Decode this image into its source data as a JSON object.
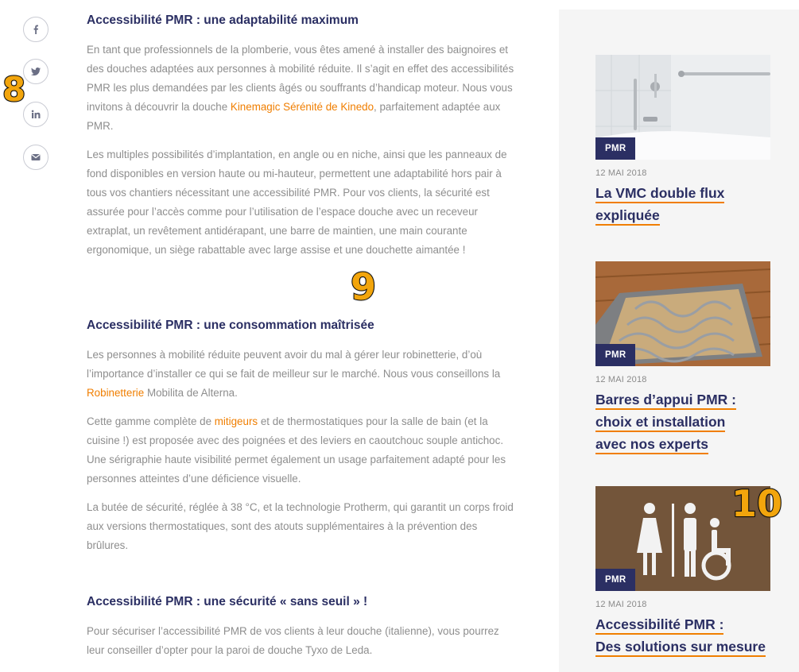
{
  "share": {
    "icons": [
      "facebook-icon",
      "twitter-icon",
      "linkedin-icon",
      "email-icon"
    ],
    "marker": "8"
  },
  "article": {
    "marker": "9",
    "sections": [
      {
        "heading": "Accessibilité PMR : une adaptabilité maximum",
        "p1_a": "En tant que professionnels de la plomberie, vous êtes amené à installer des baignoires et des douches adaptées aux personnes à mobilité réduite. Il s’agit en effet des accessibilités PMR les plus demandées par les clients âgés ou souffrants d’handicap moteur. Nous vous invitons à découvrir la douche ",
        "p1_link": "Kinemagic Sérénité de Kinedo",
        "p1_b": ", parfaitement adaptée aux PMR.",
        "p2": "Les multiples possibilités d’implantation, en angle ou en niche, ainsi que les panneaux de fond disponibles en version haute ou mi-hauteur, permettent une adaptabilité hors pair à tous vos chantiers nécessitant une accessibilité PMR. Pour vos clients, la sécurité est assurée pour l’accès comme pour l’utilisation de l’espace douche avec un receveur extraplat, un revêtement antidérapant, une barre de maintien, une main courante ergonomique, un siège rabattable avec large assise et une douchette aimantée !"
      },
      {
        "heading": "Accessibilité PMR : une consommation maîtrisée",
        "p1_a": "Les personnes à mobilité réduite peuvent avoir du mal à gérer leur robinetterie, d’où l’importance d’installer ce qui se fait de meilleur sur le marché. Nous vous conseillons la ",
        "p1_link": "Robinetterie",
        "p1_b": " Mobilita de Alterna.",
        "p2_a": "Cette gamme complète de ",
        "p2_link": "mitigeurs",
        "p2_b": " et de thermostatiques pour la salle de bain (et la cuisine !) est proposée avec des poignées et des leviers en caoutchouc souple antichoc. Une sérigraphie haute visibilité permet également un usage parfaitement adapté pour les personnes atteintes d’une déficience visuelle.",
        "p3": "La butée de sécurité, réglée à 38 °C, et la technologie Protherm, qui garantit un corps froid aux versions thermostatiques, sont des atouts supplémentaires à la prévention des brûlures."
      },
      {
        "heading": "Accessibilité PMR : une sécurité « sans seuil » !",
        "p1": "Pour sécuriser l’accessibilité PMR de vos clients à leur douche (italienne), vous pourrez leur conseiller d’opter pour la paroi de douche Tyxo de Leda."
      }
    ]
  },
  "sidebar": {
    "marker": "10",
    "cards": [
      {
        "category": "PMR",
        "date": "12 MAI 2018",
        "title_lines": [
          "La VMC double flux",
          "expliquée"
        ]
      },
      {
        "category": "PMR",
        "date": "12 MAI 2018",
        "title_lines": [
          "Barres d’appui PMR :",
          "choix et installation",
          "avec nos experts"
        ]
      },
      {
        "category": "PMR",
        "date": "12 MAI 2018",
        "title_lines": [
          "Accessibilité PMR :",
          "Des solutions sur mesure"
        ]
      }
    ]
  },
  "colors": {
    "navy": "#2b2f63",
    "orange": "#f07e00",
    "body_text": "#8e8e8e",
    "sidebar_bg": "#f5f5f5"
  }
}
